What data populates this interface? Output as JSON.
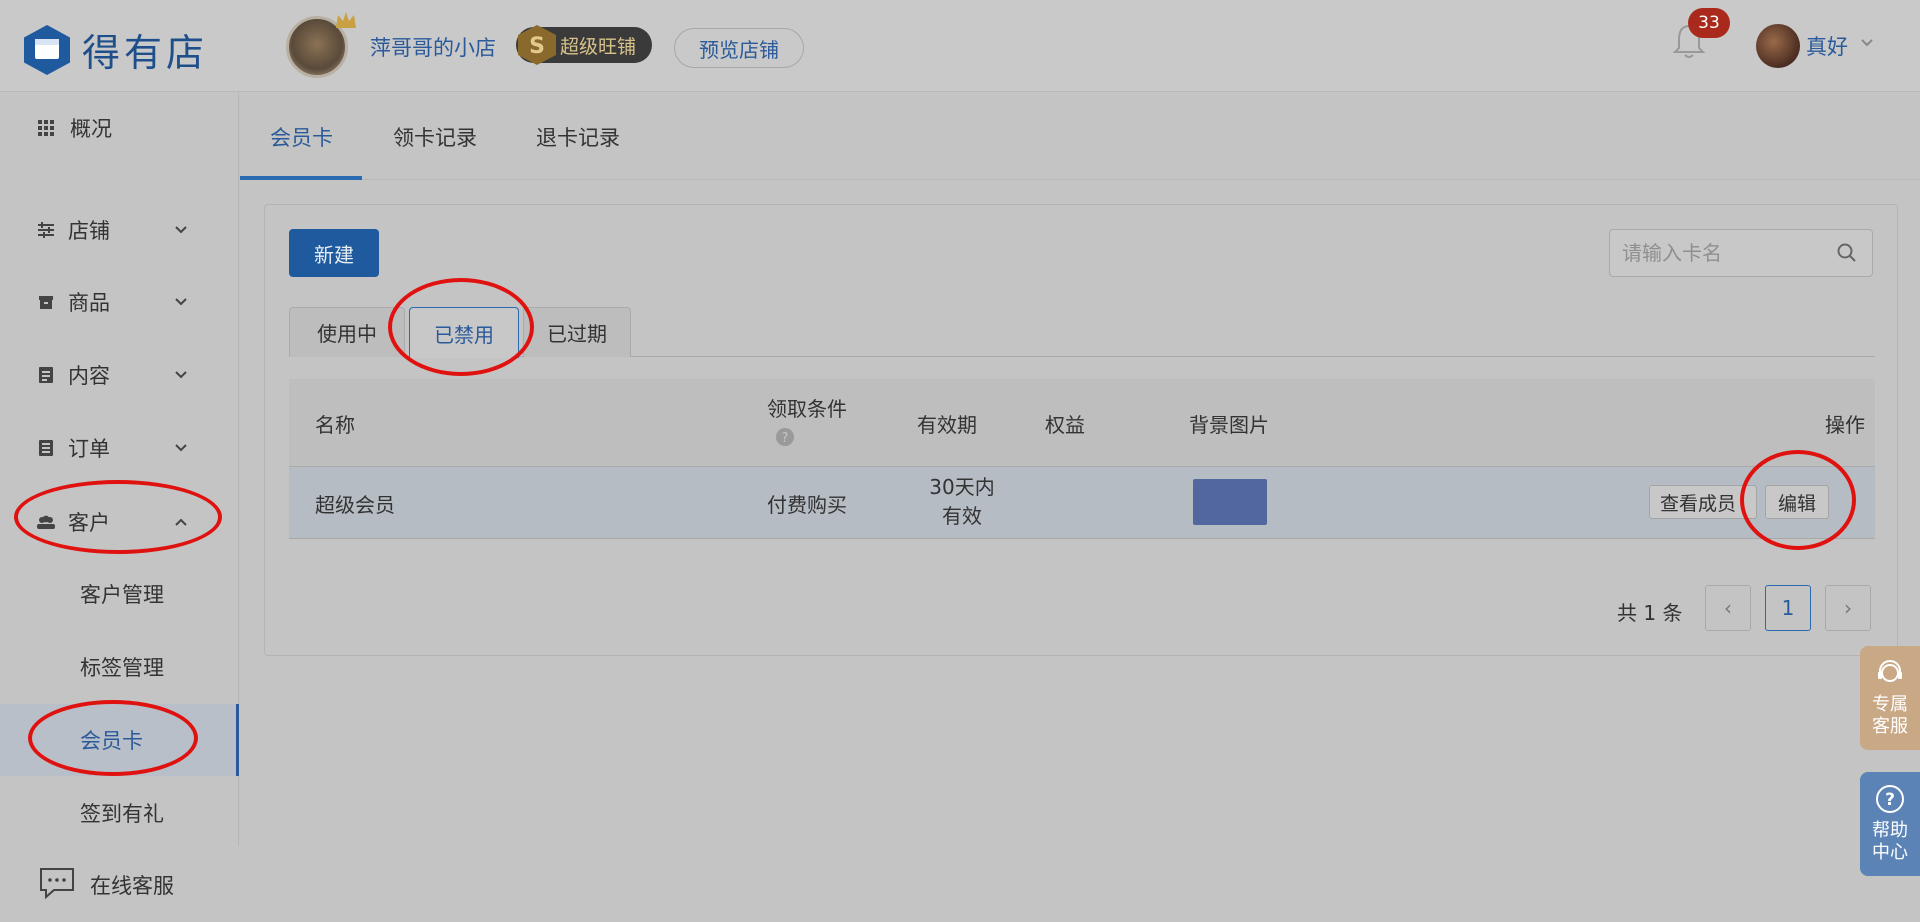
{
  "header": {
    "logo_text": "得有店",
    "shop_name": "萍哥哥的小店",
    "badge_letter": "S",
    "badge_label": "超级旺铺",
    "preview_label": "预览店铺",
    "notification_count": "33",
    "user_name": "真好"
  },
  "sidebar": {
    "overview": "概况",
    "store": "店铺",
    "products": "商品",
    "content": "内容",
    "orders": "订单",
    "customers": "客户",
    "sub": {
      "customer_mgmt": "客户管理",
      "tag_mgmt": "标签管理",
      "member_card": "会员卡",
      "checkin": "签到有礼"
    },
    "online_service": "在线客服"
  },
  "tabs": {
    "member_card": "会员卡",
    "claim_records": "领卡记录",
    "return_records": "退卡记录"
  },
  "panel": {
    "new_label": "新建",
    "search_placeholder": "请输入卡名",
    "subtabs": {
      "in_use": "使用中",
      "disabled": "已禁用",
      "expired": "已过期"
    }
  },
  "table": {
    "headers": {
      "name": "名称",
      "condition": "领取条件",
      "validity": "有效期",
      "benefits": "权益",
      "background": "背景图片",
      "actions": "操作"
    },
    "rows": [
      {
        "name": "超级会员",
        "condition": "付费购买",
        "validity_line1": "30天内",
        "validity_line2": "有效",
        "benefits": "",
        "bg_color": "#51679e",
        "view_members": "查看成员",
        "edit": "编辑"
      }
    ]
  },
  "pagination": {
    "total": "共 1 条",
    "prev": "‹",
    "current": "1",
    "next": "›"
  },
  "floats": {
    "cs_line1": "专属",
    "cs_line2": "客服",
    "help_line1": "帮助",
    "help_line2": "中心"
  },
  "colors": {
    "accent": "#2a5a9a",
    "primary_button": "#1f5a9e",
    "annotation_red": "#e0120f",
    "notification_badge": "#a92a1c"
  }
}
